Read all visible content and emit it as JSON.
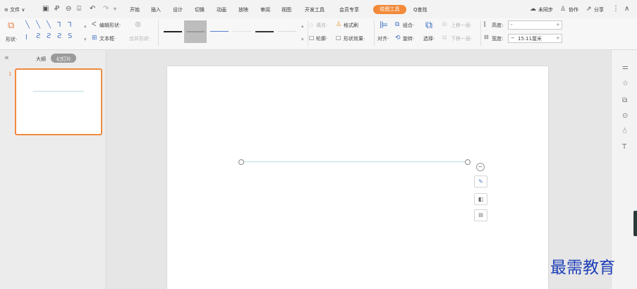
{
  "menubar": {
    "file_label": "≡ 文件 ∨",
    "tabs": [
      "开始",
      "插入",
      "设计",
      "切换",
      "动画",
      "放映",
      "审阅",
      "视图",
      "开发工具",
      "会员专享"
    ],
    "active_tab": "绘图工具",
    "search_label": "Q查找",
    "sync_label": "未同步",
    "collab_label": "协作",
    "share_label": "分享"
  },
  "ribbon": {
    "shape_label": "形状·",
    "edit_shape_label": "编辑形状·",
    "textbox_label": "文本框·",
    "merge_shape_label": "合并形状·",
    "fill_label": "填充·",
    "format_brush_label": "格式刷",
    "outline_label": "轮廓·",
    "shape_effect_label": "形状效果·",
    "align_label": "对齐·",
    "group_label": "组合·",
    "rotate_label": "旋转·",
    "select_label": "选择·",
    "move_up_label": "上移一层·",
    "move_down_label": "下移一层·",
    "height_label": "高度:",
    "height_value": "-",
    "width_label": "宽度:",
    "width_value": "15.11厘米"
  },
  "left_pane": {
    "collapse_glyph": "«",
    "outline_tab": "大纲",
    "slides_tab": "幻灯片",
    "slide_number": "1"
  },
  "watermark": "最需教育",
  "colors": {
    "accent": "#f28a3a",
    "thumb_border": "#f08a40",
    "line": "#bcdde4"
  }
}
